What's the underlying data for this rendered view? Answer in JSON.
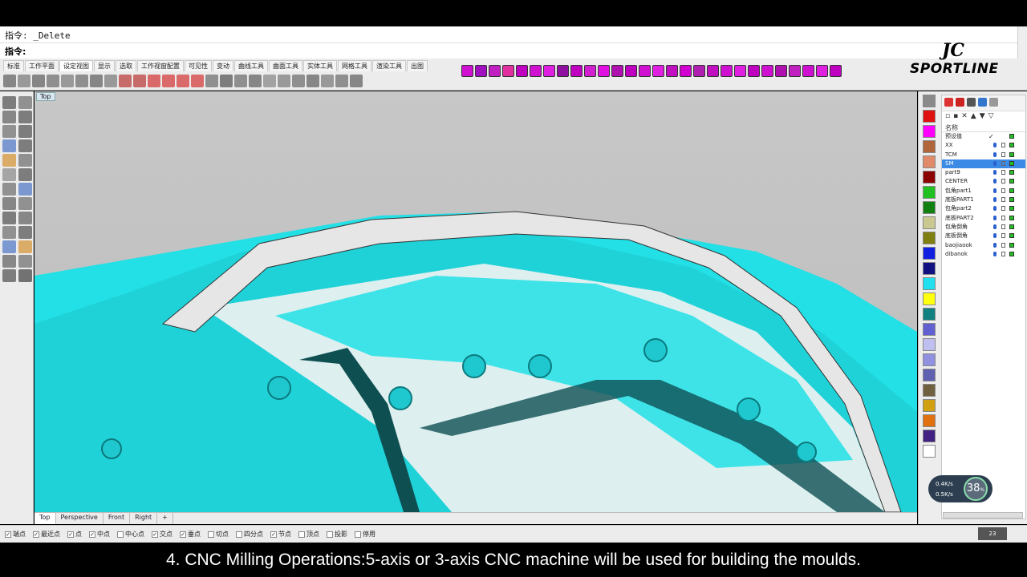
{
  "command": {
    "history": "指令: _Delete",
    "prompt": "指令:"
  },
  "logo": {
    "mark": "JC",
    "text": "SPORTLINE"
  },
  "toolbar": {
    "tabs": [
      "标准",
      "工作平面",
      "设定视图",
      "显示",
      "选取",
      "工作视窗配置",
      "可见性",
      "变动",
      "曲线工具",
      "曲面工具",
      "实体工具",
      "网格工具",
      "渲染工具",
      "出图"
    ],
    "active_tab": "设定视图"
  },
  "viewport": {
    "label": "Top",
    "tabs": [
      "Top",
      "Perspective",
      "Front",
      "Right"
    ],
    "add_tab": "+"
  },
  "colors": {
    "accent_model": "#22e0e6",
    "panel_bg": "#ececec",
    "selected_layer": "#3b8be6",
    "swatches": [
      "#8a8a8a",
      "#e01010",
      "#ff00ff",
      "#b0663a",
      "#e08a6a",
      "#8b0000",
      "#20c020",
      "#108010",
      "#c8c890",
      "#808010",
      "#1020e0",
      "#101080",
      "#20e0f0",
      "#ffff10",
      "#108080",
      "#6060d0",
      "#c0c0f0",
      "#9090e0",
      "#6060b0",
      "#706040",
      "#d0a010",
      "#e07010",
      "#402080",
      "#ffffff"
    ]
  },
  "layers": {
    "header": "名称",
    "rows": [
      {
        "name": "预设值",
        "check": "✓"
      },
      {
        "name": "XX"
      },
      {
        "name": "TCM"
      },
      {
        "name": "SM",
        "selected": true
      },
      {
        "name": "part9"
      },
      {
        "name": "CENTER"
      },
      {
        "name": "包角part1"
      },
      {
        "name": "底板PART1"
      },
      {
        "name": "包角part2"
      },
      {
        "name": "底板PART2"
      },
      {
        "name": "包角倒角"
      },
      {
        "name": "底板倒角"
      },
      {
        "name": "baojiaook"
      },
      {
        "name": "dibanok"
      }
    ]
  },
  "network": {
    "up": "0.4K/s",
    "down": "0.5K/s",
    "percent": "38",
    "percent_unit": "%"
  },
  "status": {
    "snaps": [
      {
        "label": "端点",
        "checked": true
      },
      {
        "label": "最近点",
        "checked": true
      },
      {
        "label": "点",
        "checked": true
      },
      {
        "label": "中点",
        "checked": true
      },
      {
        "label": "中心点",
        "checked": false
      },
      {
        "label": "交点",
        "checked": true
      },
      {
        "label": "垂点",
        "checked": true
      },
      {
        "label": "切点",
        "checked": false
      },
      {
        "label": "四分点",
        "checked": false
      },
      {
        "label": "节点",
        "checked": true
      },
      {
        "label": "顶点",
        "checked": false
      },
      {
        "label": "投影",
        "checked": false
      },
      {
        "label": "停用",
        "checked": false
      }
    ],
    "mini": "23"
  },
  "subtitle": "4. CNC Milling Operations:5-axis or 3-axis CNC machine will be used for building the moulds."
}
